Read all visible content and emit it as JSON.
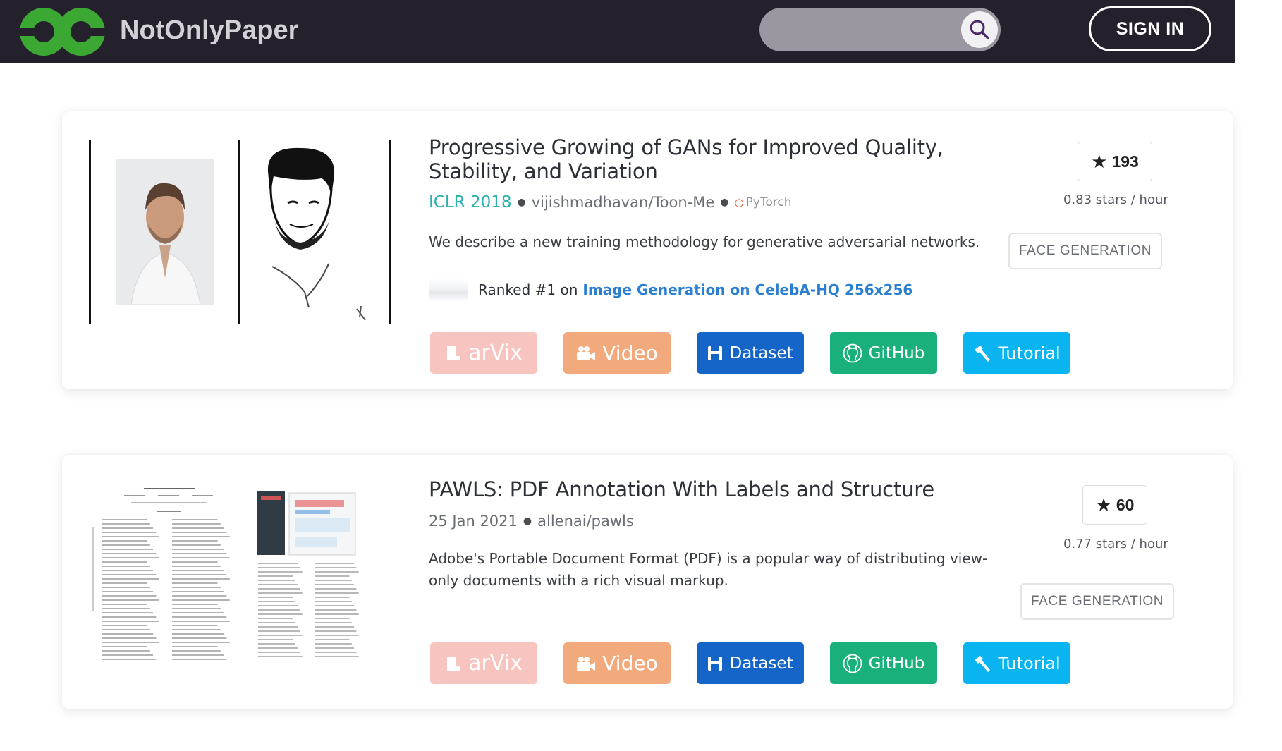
{
  "header": {
    "brand_name": "NotOnlyPaper",
    "search_placeholder": "",
    "sign_in_label": "SIGN IN",
    "colors": {
      "bar": "#25212c",
      "logo": "#3ba833"
    }
  },
  "papers": [
    {
      "title": "Progressive Growing of GANs for Improved Quality, Stability, and Variation",
      "conference": "ICLR 2018",
      "repo": "vijishmadhavan/Toon-Me",
      "framework": "PyTorch",
      "description": "We describe a new training methodology for generative adversarial networks.",
      "ranked_prefix": "Ranked #1 on",
      "ranked_task": "Image Generation on CelebA-HQ 256x256",
      "stars": "193",
      "rate": "0.83 stars / hour",
      "tag": "FACE GENERATION",
      "thumbnail": "face-to-cartoon-comparison",
      "buttons": {
        "arxiv": "arVix",
        "video": "Video",
        "dataset": "Dataset",
        "github": "GitHub",
        "tutorial": "Tutorial"
      }
    },
    {
      "title": "PAWLS: PDF Annotation With Labels and Structure",
      "date": "25 Jan 2021",
      "repo": "allenai/pawls",
      "description": "Adobe's Portable Document Format (PDF) is a popular way of distributing view-only documents with a rich visual markup.",
      "stars": "60",
      "rate": "0.77 stars / hour",
      "tag": "FACE GENERATION",
      "thumbnail": "paper-pages-preview",
      "buttons": {
        "arxiv": "arVix",
        "video": "Video",
        "dataset": "Dataset",
        "github": "GitHub",
        "tutorial": "Tutorial"
      }
    }
  ],
  "button_colors": {
    "arxiv": "#f7c4c0",
    "video": "#f2aa7c",
    "dataset": "#1565c9",
    "github": "#19b07c",
    "tutorial": "#0ab4f0"
  }
}
